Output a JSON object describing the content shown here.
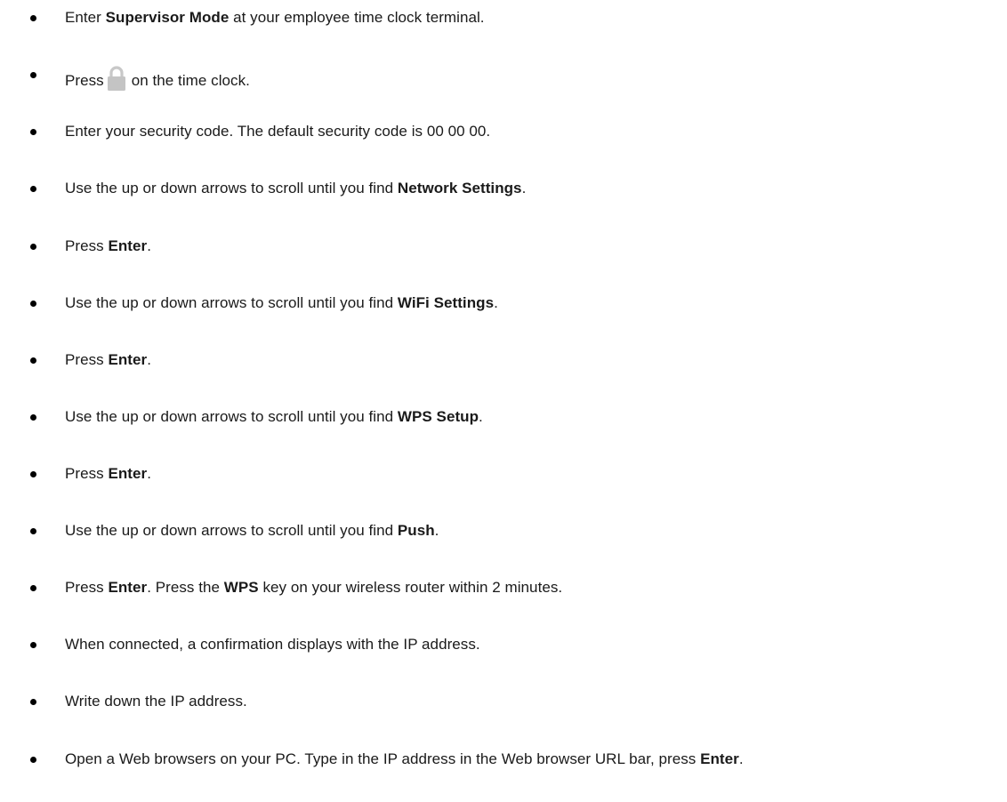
{
  "steps": [
    {
      "parts": [
        {
          "t": "Enter "
        },
        {
          "t": "Supervisor Mode",
          "b": true
        },
        {
          "t": " at your employee time clock terminal."
        }
      ]
    },
    {
      "parts": [
        {
          "t": "Press"
        },
        {
          "icon": "lock-icon"
        },
        {
          "t": "on the time clock."
        }
      ]
    },
    {
      "parts": [
        {
          "t": "Enter your security code. The default security code is 00 00 00."
        }
      ]
    },
    {
      "parts": [
        {
          "t": "Use the up or down arrows to scroll until you find "
        },
        {
          "t": "Network Settings",
          "b": true
        },
        {
          "t": "."
        }
      ]
    },
    {
      "parts": [
        {
          "t": "Press "
        },
        {
          "t": "Enter",
          "b": true
        },
        {
          "t": "."
        }
      ]
    },
    {
      "parts": [
        {
          "t": "Use the up or down arrows to scroll until you find "
        },
        {
          "t": "WiFi Settings",
          "b": true
        },
        {
          "t": "."
        }
      ]
    },
    {
      "parts": [
        {
          "t": "Press "
        },
        {
          "t": "Enter",
          "b": true
        },
        {
          "t": "."
        }
      ]
    },
    {
      "parts": [
        {
          "t": "Use the up or down arrows to scroll until you find "
        },
        {
          "t": "WPS Setup",
          "b": true
        },
        {
          "t": "."
        }
      ]
    },
    {
      "parts": [
        {
          "t": "Press "
        },
        {
          "t": "Enter",
          "b": true
        },
        {
          "t": "."
        }
      ]
    },
    {
      "parts": [
        {
          "t": "Use the up or down arrows to scroll until you find "
        },
        {
          "t": "Push",
          "b": true
        },
        {
          "t": "."
        }
      ]
    },
    {
      "parts": [
        {
          "t": "Press "
        },
        {
          "t": "Enter",
          "b": true
        },
        {
          "t": ". Press the "
        },
        {
          "t": "WPS",
          "b": true
        },
        {
          "t": " key on your wireless router within 2 minutes."
        }
      ]
    },
    {
      "parts": [
        {
          "t": "When connected, a confirmation displays with the IP address."
        }
      ]
    },
    {
      "parts": [
        {
          "t": "Write down the IP address."
        }
      ]
    },
    {
      "parts": [
        {
          "t": "Open a Web browsers on your PC. Type in the IP address in the Web browser URL bar, press "
        },
        {
          "t": "Enter",
          "b": true
        },
        {
          "t": "."
        }
      ]
    }
  ],
  "colors": {
    "text": "#1a1a1a",
    "bullet": "#000000",
    "lock_icon": "#c4c4c4"
  }
}
